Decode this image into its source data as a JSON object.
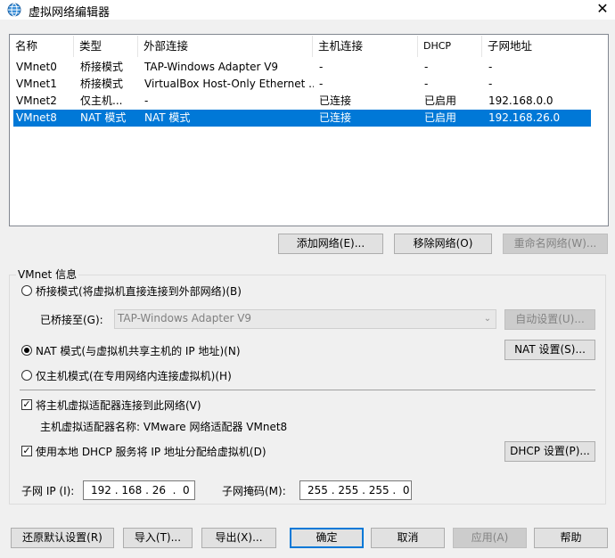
{
  "window": {
    "title": "虚拟网络编辑器",
    "close_glyph": "✕"
  },
  "table": {
    "headers": [
      "名称",
      "类型",
      "外部连接",
      "主机连接",
      "DHCP",
      "子网地址"
    ],
    "rows": [
      {
        "name": "VMnet0",
        "type": "桥接模式",
        "external": "TAP-Windows Adapter V9",
        "host": "-",
        "dhcp": "-",
        "subnet": "-",
        "selected": false
      },
      {
        "name": "VMnet1",
        "type": "桥接模式",
        "external": "VirtualBox Host-Only Ethernet ...",
        "host": "-",
        "dhcp": "-",
        "subnet": "-",
        "selected": false
      },
      {
        "name": "VMnet2",
        "type": "仅主机...",
        "external": "-",
        "host": "已连接",
        "dhcp": "已启用",
        "subnet": "192.168.0.0",
        "selected": false
      },
      {
        "name": "VMnet8",
        "type": "NAT 模式",
        "external": "NAT 模式",
        "host": "已连接",
        "dhcp": "已启用",
        "subnet": "192.168.26.0",
        "selected": true
      }
    ]
  },
  "list_buttons": {
    "add": "添加网络(E)...",
    "remove": "移除网络(O)",
    "rename": "重命名网络(W)..."
  },
  "vmnet_info": {
    "group_title": "VMnet 信息",
    "bridged_label": "桥接模式(将虚拟机直接连接到外部网络)(B)",
    "bridged_to_label": "已桥接至(G):",
    "bridged_to_value": "TAP-Windows Adapter V9",
    "combo_arrow": "⌄",
    "auto_settings": "自动设置(U)...",
    "nat_label": "NAT 模式(与虚拟机共享主机的 IP 地址)(N)",
    "nat_settings": "NAT 设置(S)...",
    "hostonly_label": "仅主机模式(在专用网络内连接虚拟机)(H)",
    "selected_mode": "nat",
    "connect_adapter_label": "将主机虚拟适配器连接到此网络(V)",
    "connect_adapter_checked": true,
    "adapter_name_label": "主机虚拟适配器名称: VMware 网络适配器 VMnet8",
    "dhcp_label": "使用本地 DHCP 服务将 IP 地址分配给虚拟机(D)",
    "dhcp_checked": true,
    "check_glyph": "✓",
    "dhcp_settings": "DHCP 设置(P)...",
    "subnet_ip_label": "子网 IP (I):",
    "subnet_ip_value": "192 . 168 . 26  .  0",
    "subnet_mask_label": "子网掩码(M):",
    "subnet_mask_value": "255 . 255 . 255 .  0"
  },
  "footer": {
    "restore": "还原默认设置(R)",
    "import": "导入(T)...",
    "export": "导出(X)...",
    "ok": "确定",
    "cancel": "取消",
    "apply": "应用(A)",
    "help": "帮助"
  },
  "colors": {
    "selection": "#0078d7",
    "background": "#f0f0f0"
  }
}
